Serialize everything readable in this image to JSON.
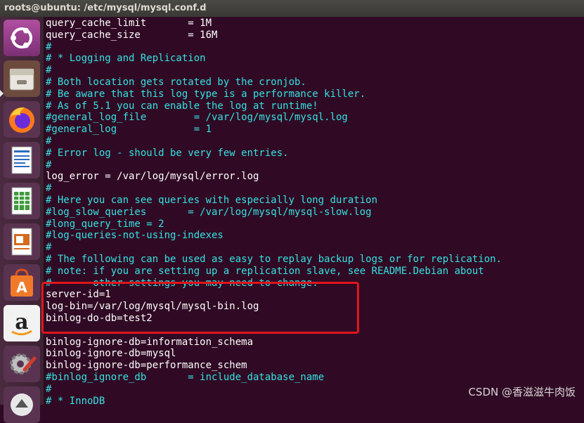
{
  "window": {
    "title": "roots@ubuntu: /etc/mysql/mysql.conf.d"
  },
  "launcher": {
    "items": [
      {
        "name": "ubuntu-dash-icon"
      },
      {
        "name": "files-icon"
      },
      {
        "name": "firefox-icon"
      },
      {
        "name": "libreoffice-writer-icon"
      },
      {
        "name": "libreoffice-calc-icon"
      },
      {
        "name": "libreoffice-impress-icon"
      },
      {
        "name": "software-center-icon"
      },
      {
        "name": "amazon-icon"
      },
      {
        "name": "system-settings-icon"
      },
      {
        "name": "update-icon"
      }
    ]
  },
  "terminal": {
    "lines": [
      {
        "text": "query_cache_limit       = 1M",
        "type": "setting"
      },
      {
        "text": "query_cache_size        = 16M",
        "type": "setting"
      },
      {
        "text": "#",
        "type": "comment"
      },
      {
        "text": "# * Logging and Replication",
        "type": "comment"
      },
      {
        "text": "#",
        "type": "comment"
      },
      {
        "text": "# Both location gets rotated by the cronjob.",
        "type": "comment"
      },
      {
        "text": "# Be aware that this log type is a performance killer.",
        "type": "comment"
      },
      {
        "text": "# As of 5.1 you can enable the log at runtime!",
        "type": "comment"
      },
      {
        "text": "#general_log_file        = /var/log/mysql/mysql.log",
        "type": "comment"
      },
      {
        "text": "#general_log             = 1",
        "type": "comment"
      },
      {
        "text": "#",
        "type": "comment"
      },
      {
        "text": "# Error log - should be very few entries.",
        "type": "comment"
      },
      {
        "text": "#",
        "type": "comment"
      },
      {
        "text": "log_error = /var/log/mysql/error.log",
        "type": "setting"
      },
      {
        "text": "#",
        "type": "comment"
      },
      {
        "text": "# Here you can see queries with especially long duration",
        "type": "comment"
      },
      {
        "text": "#log_slow_queries       = /var/log/mysql/mysql-slow.log",
        "type": "comment"
      },
      {
        "text": "#long_query_time = 2",
        "type": "comment"
      },
      {
        "text": "#log-queries-not-using-indexes",
        "type": "comment"
      },
      {
        "text": "#",
        "type": "comment"
      },
      {
        "text": "# The following can be used as easy to replay backup logs or for replication.",
        "type": "comment"
      },
      {
        "text": "# note: if you are setting up a replication slave, see README.Debian about",
        "type": "comment"
      },
      {
        "text": "#       other settings you may need to change.",
        "type": "comment"
      },
      {
        "text": "server-id=1",
        "type": "setting"
      },
      {
        "text": "log-bin=/var/log/mysql/mysql-bin.log",
        "type": "setting"
      },
      {
        "text": "binlog-do-db=test2",
        "type": "setting"
      },
      {
        "text": "",
        "type": "setting"
      },
      {
        "text": "binlog-ignore-db=information_schema",
        "type": "setting"
      },
      {
        "text": "binlog-ignore-db=mysql",
        "type": "setting"
      },
      {
        "text": "binlog-ignore-db=performance_schem",
        "type": "setting"
      },
      {
        "text": "#binlog_ignore_db       = include_database_name",
        "type": "comment"
      },
      {
        "text": "#",
        "type": "comment"
      },
      {
        "text": "# * InnoDB",
        "type": "comment"
      }
    ]
  },
  "watermark": {
    "text": "CSDN @香滋滋牛肉饭"
  },
  "colors": {
    "terminal_bg": "#300a24",
    "comment": "#34e2e2",
    "text": "#ffffff",
    "highlight": "#e0151d"
  }
}
